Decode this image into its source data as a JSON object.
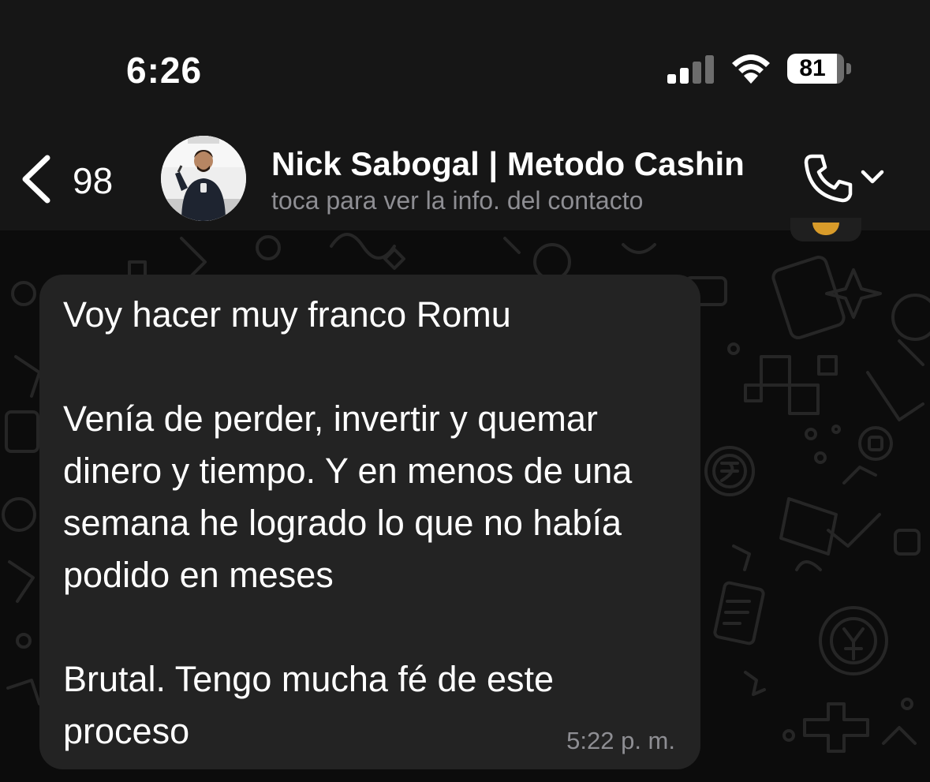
{
  "status_bar": {
    "time": "6:26",
    "battery": "81"
  },
  "header": {
    "back_count": "98",
    "contact_name": "Nick Sabogal | Metodo Cashin",
    "subtitle": "toca para ver la info. del contacto"
  },
  "message": {
    "text": "Voy hacer muy franco Romu\n\nVenía de perder, invertir y quemar dinero y tiempo. Y en menos de una semana he logrado lo que no había podido en meses\n\nBrutal. Tengo mucha fé de este proceso",
    "time": "5:22 p. m."
  },
  "colors": {
    "bubble": "#232323",
    "header": "#161616",
    "secondary_text": "#8e8e93"
  }
}
